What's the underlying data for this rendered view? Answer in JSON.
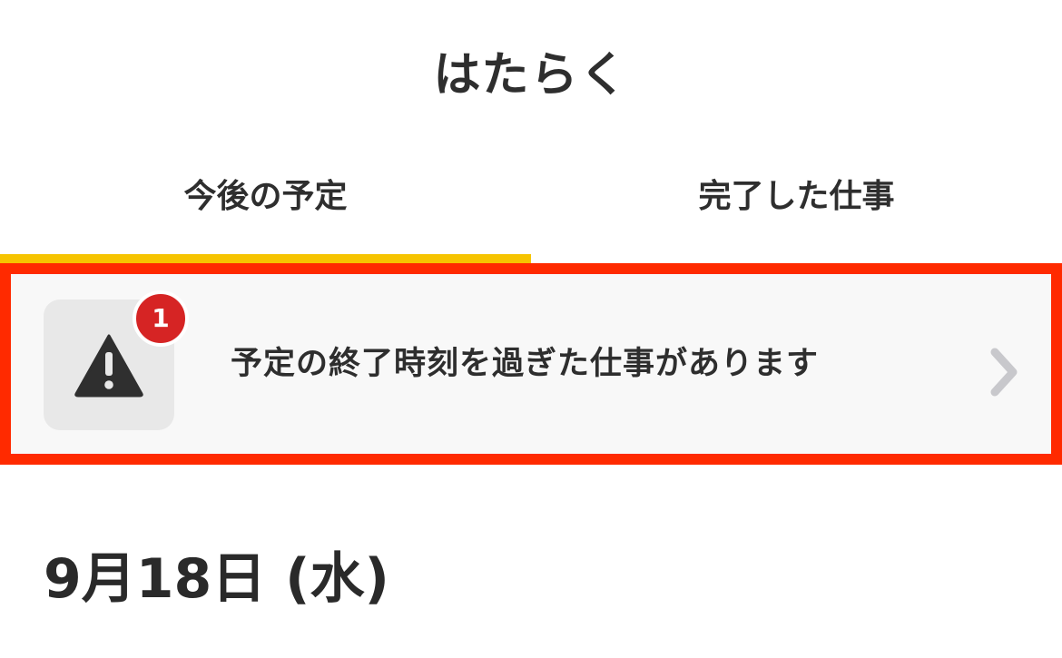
{
  "header": {
    "title": "はたらく"
  },
  "tabs": [
    {
      "label": "今後の予定",
      "selected": true
    },
    {
      "label": "完了した仕事",
      "selected": false
    }
  ],
  "alert": {
    "badge_count": "1",
    "message": "予定の終了時刻を過ぎた仕事があります",
    "icon": "warning-icon",
    "highlight_color": "#ff2a00"
  },
  "date_section": {
    "heading": "9月18日 (水)"
  },
  "colors": {
    "tab_underline": "#f6c400",
    "badge": "#d62424"
  }
}
